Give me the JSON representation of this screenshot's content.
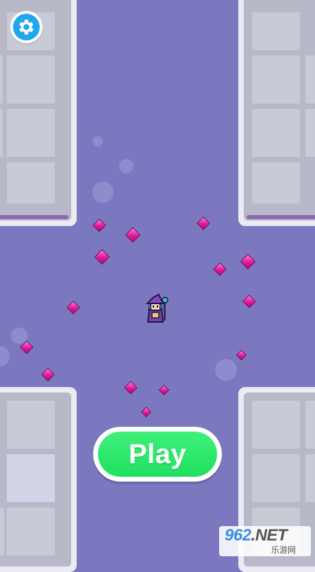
{
  "game": {
    "play_label": "Play",
    "watermark_brand": "962",
    "watermark_suffix": ".NET",
    "watermark_sub": "乐游网"
  },
  "icons": {
    "settings": "gear-icon",
    "character": "wizard-icon",
    "collectible": "pink-gem-icon"
  },
  "colors": {
    "background": "#7c78c0",
    "play_button": "#2ee86b",
    "settings_button": "#1ea6ee",
    "gem": "#e0199a"
  }
}
